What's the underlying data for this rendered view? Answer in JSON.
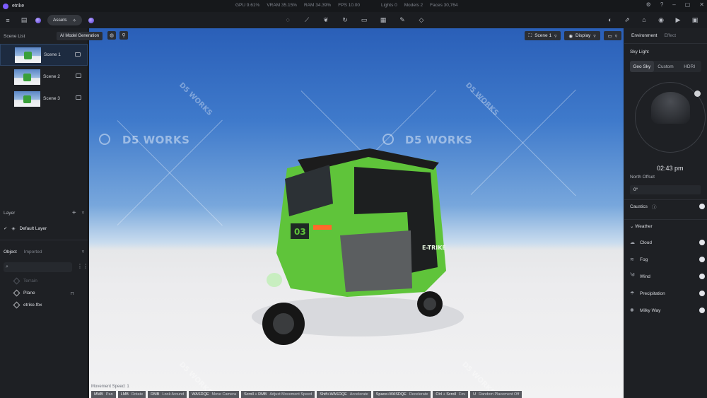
{
  "window": {
    "title": "etrike"
  },
  "stats": {
    "gpu": "GPU 9.61%",
    "vram": "VRAM 35.15%",
    "ram": "RAM 34.39%",
    "fps": "FPS 10.00",
    "lights": "Lights 0",
    "models": "Models 2",
    "faces": "Faces 30,764"
  },
  "toolbar": {
    "assets_label": "Assets",
    "tooltip": "AI Model Generation"
  },
  "scene_list": {
    "title": "Scene List",
    "items": [
      {
        "label": "Scene 1"
      },
      {
        "label": "Scene 2"
      },
      {
        "label": "Scene 3"
      }
    ]
  },
  "layer": {
    "title": "Layer",
    "default": "Default Layer"
  },
  "objects": {
    "tab_object": "Object",
    "tab_imported": "Imported",
    "items": [
      {
        "label": "Terrain"
      },
      {
        "label": "Plane"
      },
      {
        "label": "etrike.fbx"
      }
    ]
  },
  "viewport": {
    "scene_select": "Scene 1",
    "display_label": "Display",
    "watermark": "D5 WORKS",
    "movement_speed": "Movement Speed: 1",
    "hints": [
      {
        "key": "MMB",
        "action": "Pan"
      },
      {
        "key": "LMB",
        "action": "Rotate"
      },
      {
        "key": "RMB",
        "action": "Look Around"
      },
      {
        "key": "WASDQE",
        "action": "Move Camera"
      },
      {
        "key": "Scroll + RMB",
        "action": "Adjust Movement Speed"
      },
      {
        "key": "Shift+WASDQE",
        "action": "Accelerate"
      },
      {
        "key": "Space+WASDQE",
        "action": "Decelerate"
      },
      {
        "key": "Ctrl + Scroll",
        "action": "Fov"
      },
      {
        "key": "U",
        "action": "Random Placement Off"
      }
    ]
  },
  "right_panel": {
    "tab_environment": "Environment",
    "tab_effect": "Effect",
    "sky_light": "Sky Light",
    "sky_modes": [
      "Geo Sky",
      "Custom",
      "HDRI"
    ],
    "time": "02:43 pm",
    "north_offset_label": "North Offset",
    "north_offset_value": "0°",
    "caustics": "Caustics",
    "weather_title": "Weather",
    "weather_items": [
      {
        "label": "Cloud"
      },
      {
        "label": "Fog"
      },
      {
        "label": "Wind"
      },
      {
        "label": "Precipitation"
      },
      {
        "label": "Milky Way"
      }
    ]
  },
  "vehicle": {
    "number": "03",
    "brand": "E-TRIKE"
  }
}
